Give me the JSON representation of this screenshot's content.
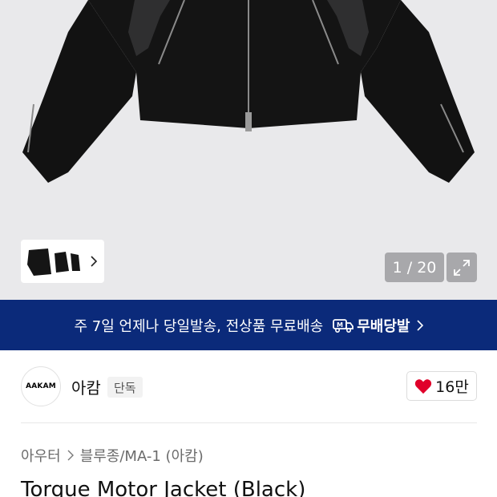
{
  "gallery": {
    "counter": "1 / 20"
  },
  "banner": {
    "text": "주 7일 언제나 당일발송, 전상품 무료배송",
    "badge_label": "무배당발"
  },
  "brand": {
    "logo_text": "AAKAM",
    "name": "아캄",
    "tag": "단독",
    "like_count": "16만"
  },
  "breadcrumb": {
    "items": [
      "아우터",
      "블루종/MA-1 (아캄)"
    ]
  },
  "product": {
    "title": "Torque Motor Jacket (Black)"
  },
  "colors": {
    "banner_bg": "#0b2a7a",
    "heart": "#e0002a"
  }
}
